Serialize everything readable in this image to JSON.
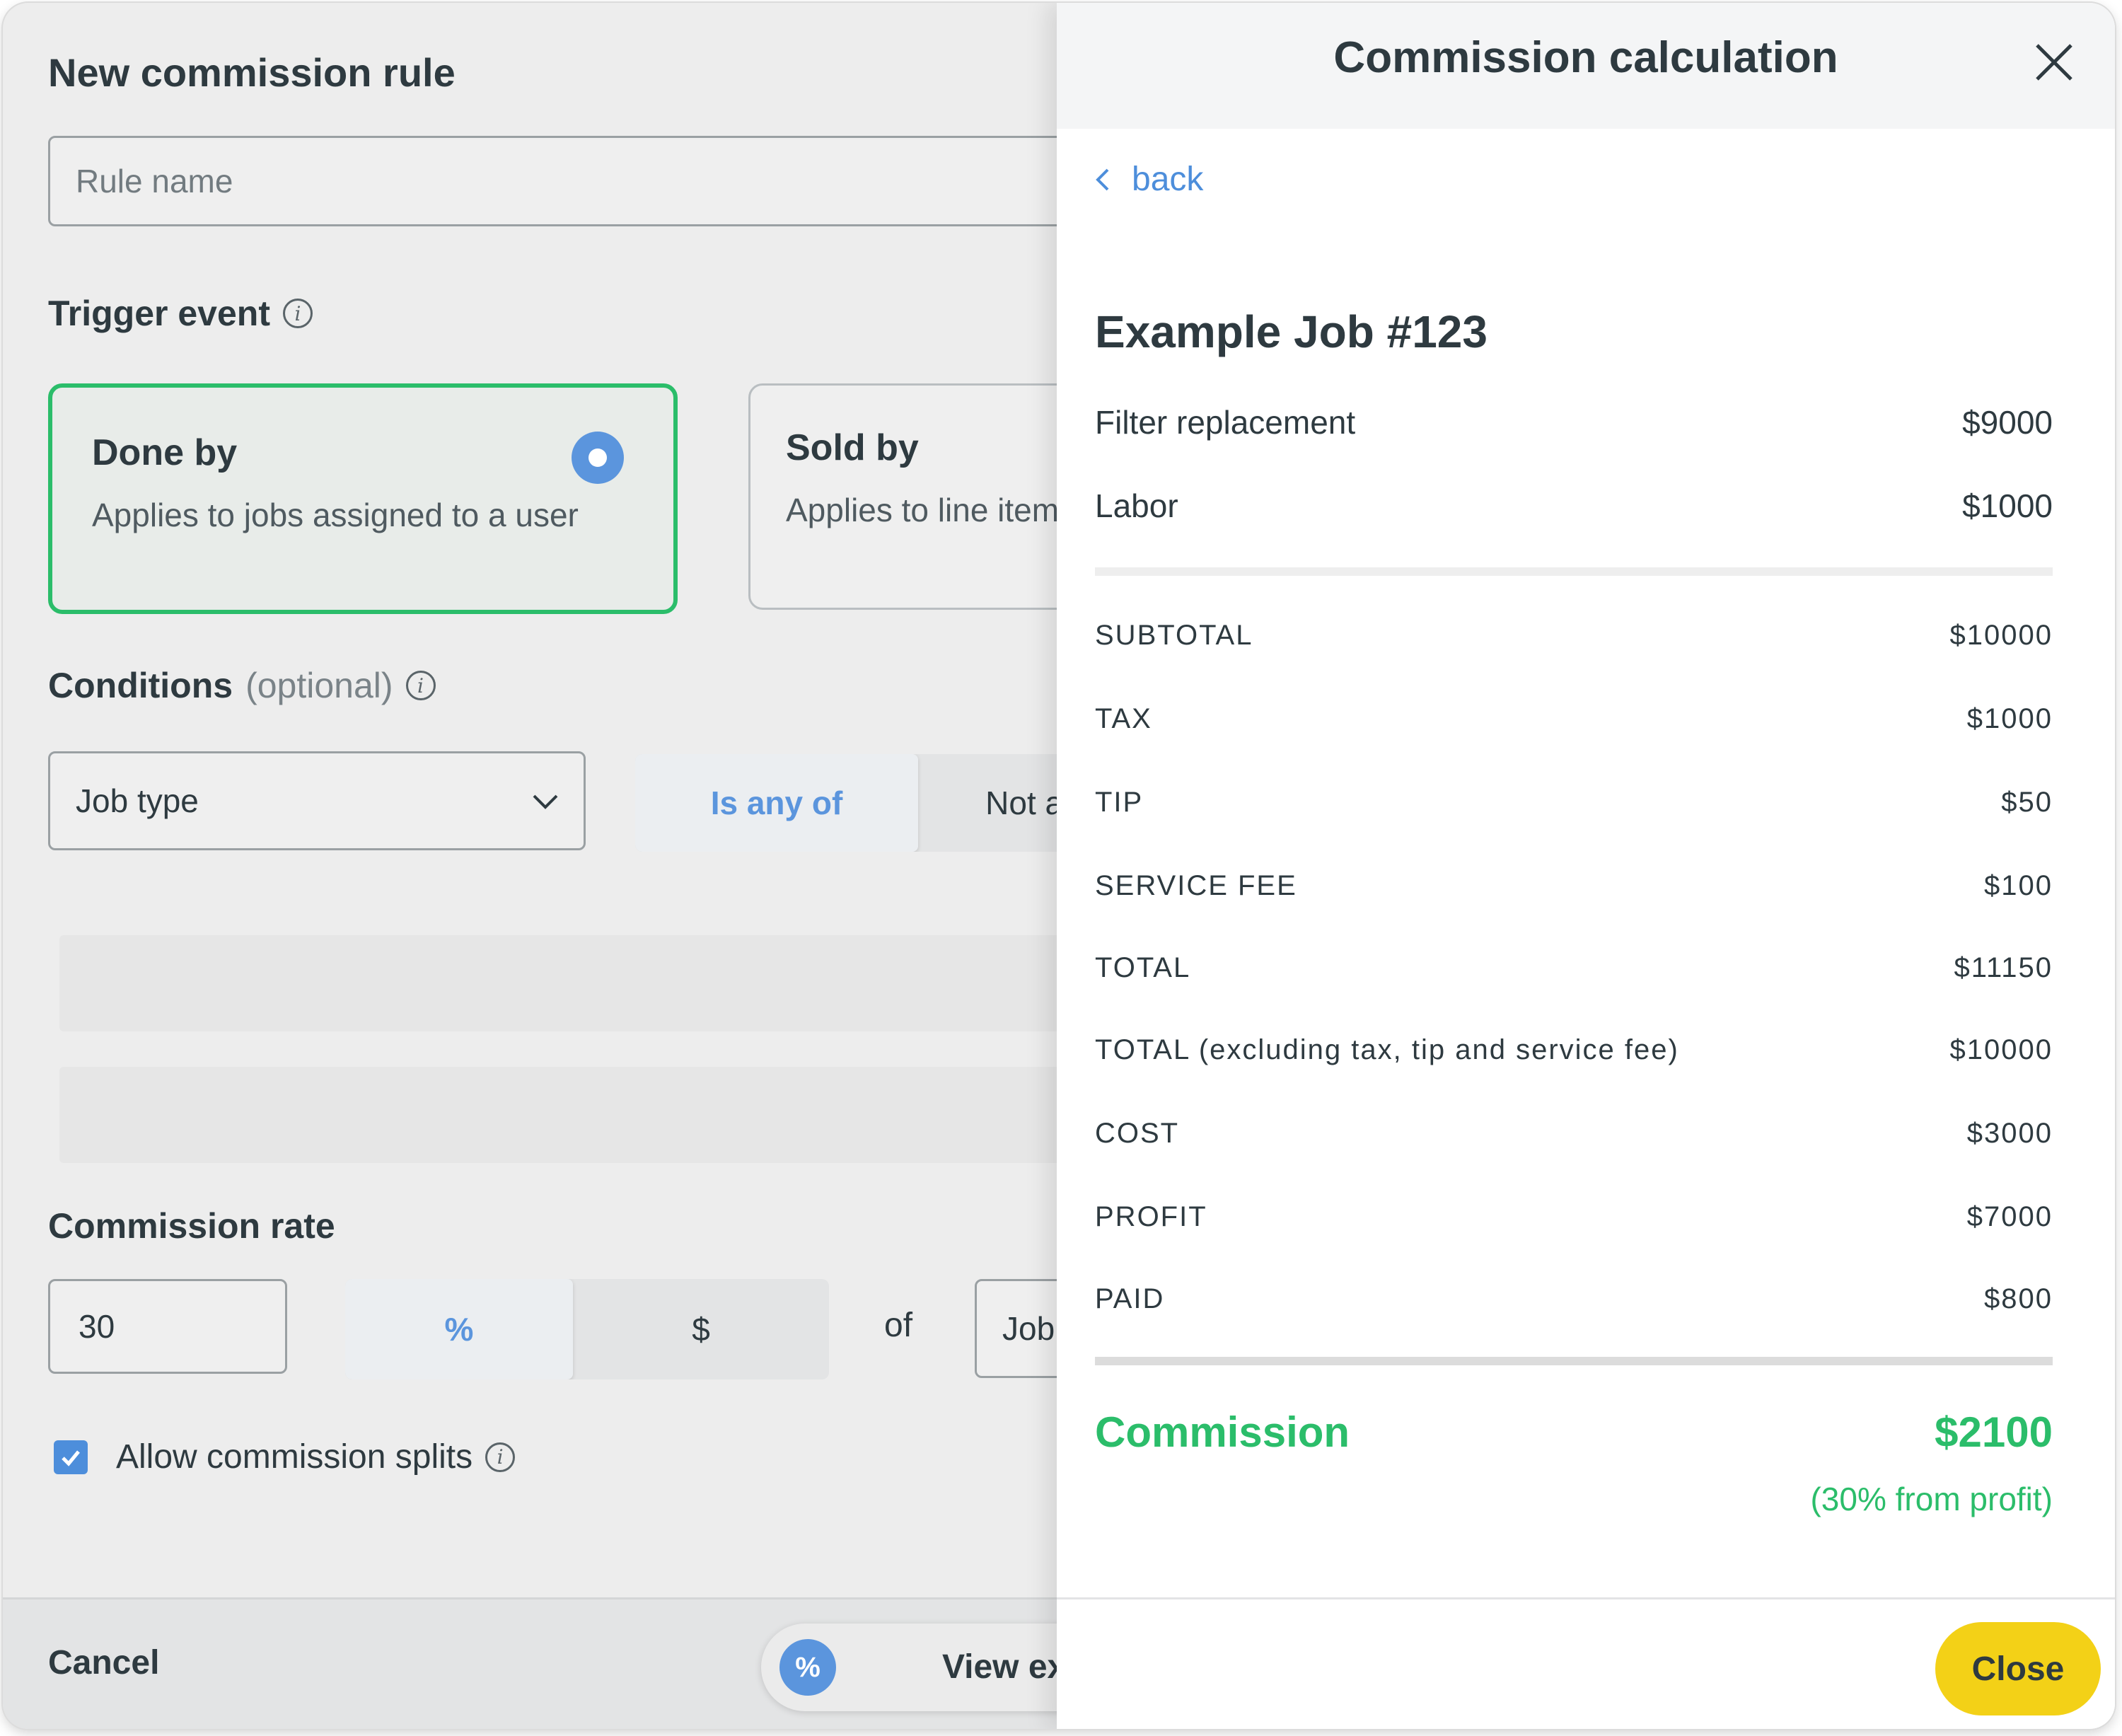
{
  "form": {
    "title": "New commission rule",
    "rule_name_placeholder": "Rule name",
    "trigger_label": "Trigger event",
    "trigger_cards": [
      {
        "title": "Done by",
        "desc": "Applies to jobs assigned to a user",
        "selected": true
      },
      {
        "title": "Sold by",
        "desc": "Applies to line items sold by a user",
        "selected": false
      }
    ],
    "conditions_label": "Conditions",
    "conditions_optional": "(optional)",
    "condition_field": "Job type",
    "condition_operators": [
      "Is any of",
      "Not any of"
    ],
    "rate_label": "Commission rate",
    "rate_value": "30",
    "rate_units": [
      "%",
      "$"
    ],
    "of_label": "of",
    "basis_value": "Job profit",
    "allow_splits_label": "Allow commission splits",
    "allow_splits_checked": true
  },
  "footer": {
    "cancel_label": "Cancel",
    "view_example_icon": "%",
    "view_example_label": "View example"
  },
  "panel": {
    "title": "Commission calculation",
    "back_label": "back",
    "job_title": "Example Job #123",
    "line_items": [
      {
        "label": "Filter replacement",
        "value": "$9000"
      },
      {
        "label": "Labor",
        "value": "$1000"
      }
    ],
    "summary": [
      {
        "label": "SUBTOTAL",
        "value": "$10000"
      },
      {
        "label": "TAX",
        "value": "$1000"
      },
      {
        "label": "TIP",
        "value": "$50"
      },
      {
        "label": "SERVICE FEE",
        "value": "$100"
      },
      {
        "label": "TOTAL",
        "value": "$11150"
      },
      {
        "label": "TOTAL (excluding tax, tip and service fee)",
        "value": "$10000"
      },
      {
        "label": "COST",
        "value": "$3000"
      },
      {
        "label": "PROFIT",
        "value": "$7000"
      },
      {
        "label": "PAID",
        "value": "$800"
      }
    ],
    "commission_label": "Commission",
    "commission_value": "$2100",
    "commission_note": "(30% from profit)",
    "close_label": "Close"
  },
  "colors": {
    "accent_blue": "#5b95dd",
    "success_green": "#2bbd6a",
    "close_yellow": "#f3d117"
  },
  "icons": [
    "info-icon",
    "chevron-down-icon",
    "close-icon",
    "chevron-left-icon",
    "check-icon",
    "percent-icon"
  ]
}
